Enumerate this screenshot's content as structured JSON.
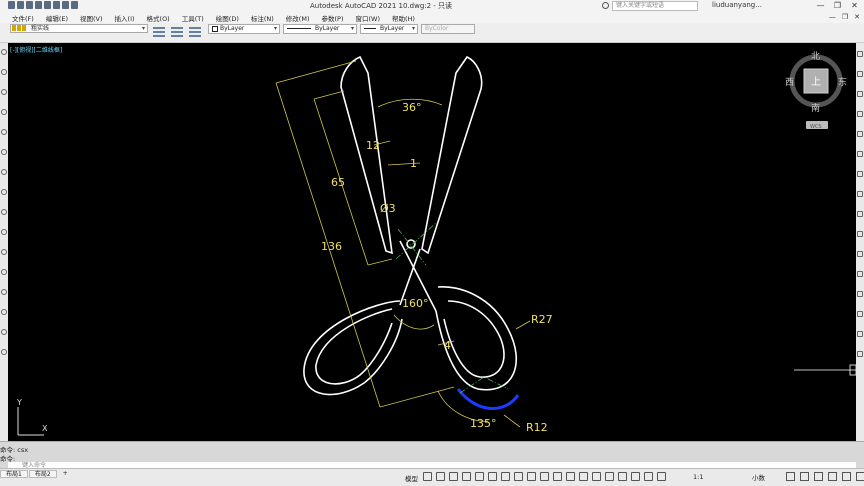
{
  "window": {
    "title": "Autodesk AutoCAD 2021    10.dwg:2 - 只读",
    "search_placeholder": "键入关键字或短语",
    "user": "liuduanyang...",
    "controls": [
      "—",
      "❐",
      "✕"
    ]
  },
  "menu": {
    "items": [
      "文件(F)",
      "编辑(E)",
      "视图(V)",
      "插入(I)",
      "格式(O)",
      "工具(T)",
      "绘图(D)",
      "标注(N)",
      "修改(M)",
      "参数(P)",
      "窗口(W)",
      "帮助(H)"
    ],
    "right": [
      "—",
      "❐",
      "✕"
    ]
  },
  "toolbar": {
    "layer_name": "粗实线",
    "color": "ByLayer",
    "linetype": "ByLayer",
    "lineweight": "ByLayer",
    "plotstyle": "ByColor"
  },
  "canvas": {
    "view_label": "[-][俯视][二维线框]",
    "background": "#000000",
    "drawing_color": "#ffffff",
    "dimension_color": "#f0e060",
    "center_color": "#4caf50",
    "highlight_color": "#1a3cff",
    "dimensions": {
      "angle_top": "36°",
      "width_12": "12",
      "one": "1",
      "len_65": "65",
      "dia_3": "Ø3",
      "len_136": "136",
      "angle_160": "160°",
      "r27": "R27",
      "four": "4",
      "angle_135": "135°",
      "r12": "R12"
    }
  },
  "viewcube": {
    "north": "北",
    "south": "南",
    "east": "东",
    "west": "西",
    "face": "上",
    "wcs": "WCS"
  },
  "ucs": {
    "y": "Y",
    "x": "X"
  },
  "command": {
    "history": [
      "命令: csx",
      "命令:"
    ],
    "placeholder": "键入命令"
  },
  "status": {
    "tabs": [
      "布局1",
      "布局2"
    ],
    "add_tab": "+",
    "model": "模型",
    "scale": "1:1",
    "units": "小数"
  }
}
